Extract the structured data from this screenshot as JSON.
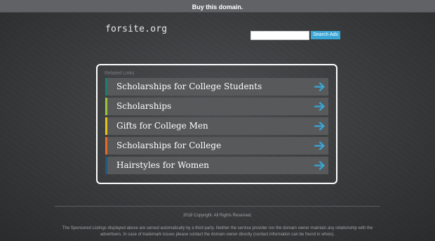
{
  "topbar": {
    "buy_label": "Buy this domain."
  },
  "header": {
    "logo": "forsite.org",
    "search_placeholder": "",
    "search_button_label": "Search Ads"
  },
  "related": {
    "heading": "Related Links",
    "items": [
      {
        "label": "Scholarships for College Students",
        "color": "#1e7d6f",
        "icon": "arrow-right-icon"
      },
      {
        "label": "Scholarships",
        "color": "#9ec43f",
        "icon": "arrow-right-icon"
      },
      {
        "label": "Gifts for College Men",
        "color": "#e8c21e",
        "icon": "arrow-right-icon"
      },
      {
        "label": "Scholarships for College",
        "color": "#e8692a",
        "icon": "arrow-right-icon"
      },
      {
        "label": "Hairstyles for Women",
        "color": "#1f5a7c",
        "icon": "arrow-right-icon"
      }
    ],
    "arrow_color": "#3aa6d6"
  },
  "footer": {
    "copyright": "2018 Copyright. All Rights Reserved.",
    "disclaimer": "The Sponsored Listings displayed above are served automatically by a third party. Neither the service provider nor the domain owner maintain any relationship with the advertisers. In case of trademark issues please contact the domain owner directly (contact information can be found in whois)."
  }
}
